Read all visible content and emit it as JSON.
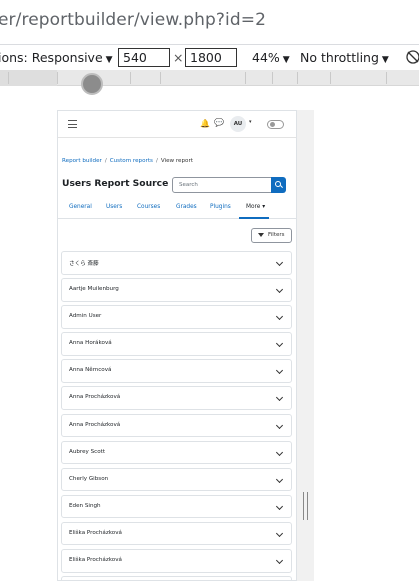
{
  "browser": {
    "url": "er/reportbuilder/view.php?id=2"
  },
  "devtools": {
    "dimensions_label": "ions: Responsive",
    "width_value": "540",
    "times": "×",
    "height_value": "1800",
    "zoom": "44%",
    "throttling": "No throttling",
    "dropdown_glyph": "▼"
  },
  "page": {
    "navbar": {
      "avatar_initials": "AU",
      "bell_glyph": "🔔",
      "chat_glyph": "💬",
      "caret_glyph": "▾"
    },
    "breadcrumb": [
      {
        "label": "Report builder",
        "link": true
      },
      {
        "label": "Custom reports",
        "link": true
      },
      {
        "label": "View report",
        "link": false
      }
    ],
    "breadcrumb_sep": "/",
    "title": "Users Report Source",
    "search_placeholder": "Search",
    "tabs": [
      "General",
      "Users",
      "Courses",
      "Grades",
      "Plugins",
      "More ▾"
    ],
    "filters_label": "Filters",
    "rows": [
      "さくら 斎藤",
      "Aartje Muilenburg",
      "Admin User",
      "Anna Horáková",
      "Anna Němcová",
      "Anna Procházková",
      "Anna Procházková",
      "Aubrey Scott",
      "Cherly Gibson",
      "Eden Singh",
      "Eliška Procházková",
      "Eliška Procházková"
    ]
  }
}
